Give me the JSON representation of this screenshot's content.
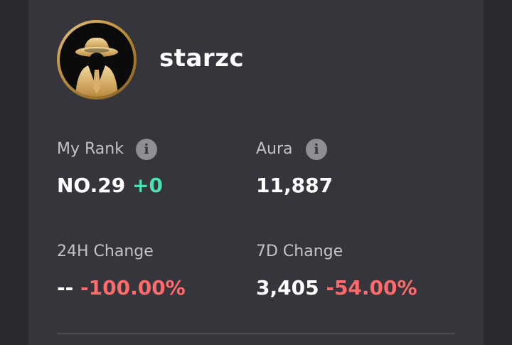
{
  "profile": {
    "username": "starzc",
    "avatar_icon": "detective-hat-avatar"
  },
  "stats": {
    "rank": {
      "label": "My Rank",
      "value": "NO.29",
      "change": "+0"
    },
    "aura": {
      "label": "Aura",
      "value": "11,887"
    },
    "change_24h": {
      "label": "24H Change",
      "value": "--",
      "change": "-100.00%"
    },
    "change_7d": {
      "label": "7D Change",
      "value": "3,405",
      "change": "-54.00%"
    },
    "info_glyph": "i"
  },
  "colors": {
    "positive": "#4de0b2",
    "negative": "#ff6b6b",
    "card_bg": "#35353b"
  }
}
